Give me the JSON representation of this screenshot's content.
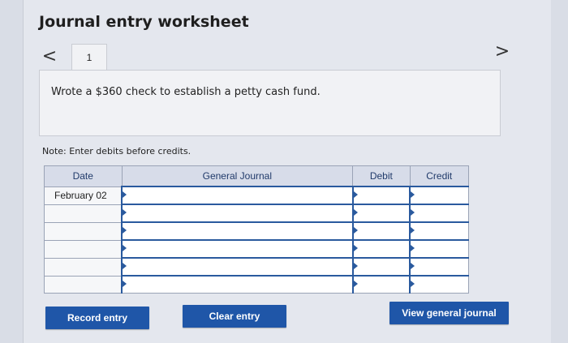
{
  "header": {
    "title": "Journal entry worksheet"
  },
  "nav": {
    "prev_icon": "chevron-left-icon",
    "next_icon": "chevron-right-icon",
    "prev_glyph": "<",
    "next_glyph": ">"
  },
  "tabs": [
    {
      "label": "1"
    }
  ],
  "transaction": {
    "description": "Wrote a $360 check to establish a petty cash fund."
  },
  "note": "Note: Enter debits before credits.",
  "table": {
    "columns": [
      "Date",
      "General Journal",
      "Debit",
      "Credit"
    ],
    "rows": [
      {
        "date": "February 02",
        "account": "",
        "debit": "",
        "credit": ""
      },
      {
        "date": "",
        "account": "",
        "debit": "",
        "credit": ""
      },
      {
        "date": "",
        "account": "",
        "debit": "",
        "credit": ""
      },
      {
        "date": "",
        "account": "",
        "debit": "",
        "credit": ""
      },
      {
        "date": "",
        "account": "",
        "debit": "",
        "credit": ""
      },
      {
        "date": "",
        "account": "",
        "debit": "",
        "credit": ""
      }
    ]
  },
  "buttons": {
    "record": "Record entry",
    "clear": "Clear entry",
    "view": "View general journal"
  },
  "colors": {
    "button": "#1f56a8",
    "header_bg": "#d7dce9",
    "input_accent": "#2a5a9e"
  }
}
